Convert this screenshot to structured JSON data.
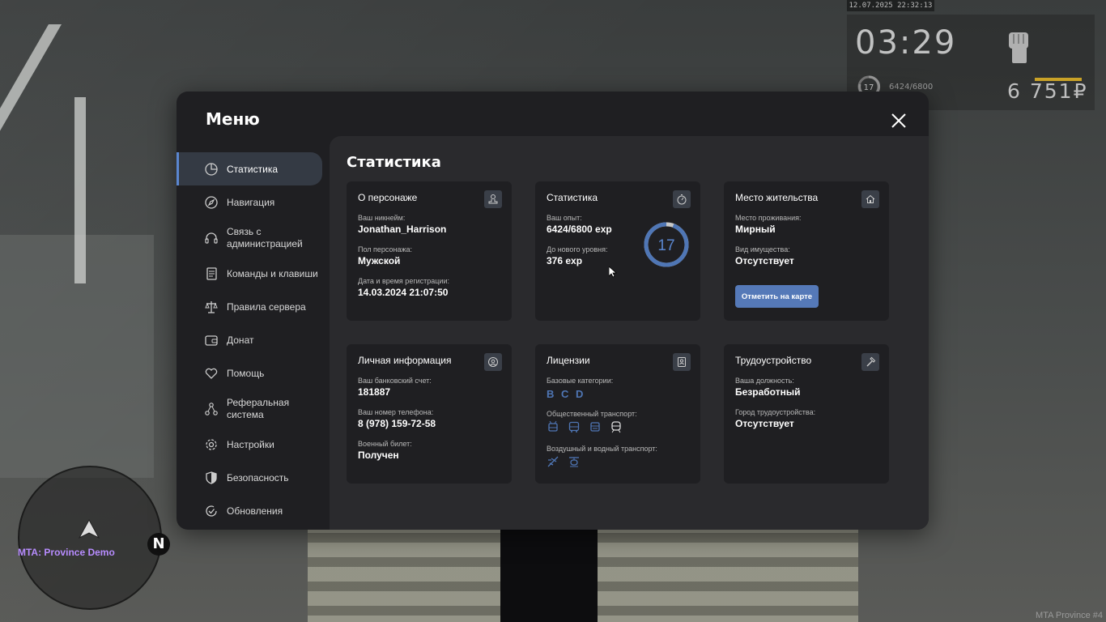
{
  "hud": {
    "datetime": "12.07.2025 22:32:13",
    "time": "03:29",
    "level": "17",
    "exp": "6424/6800",
    "money": "6 751₽"
  },
  "radar": {
    "north": "N"
  },
  "server_label": "MTA: Province Demo",
  "corner_label": "MTA Province #4",
  "menu": {
    "title": "Меню",
    "items": [
      {
        "label": "Статистика",
        "icon": "pie-chart-icon",
        "active": true
      },
      {
        "label": "Навигация",
        "icon": "compass-icon"
      },
      {
        "label": "Связь с\nадминистрацией",
        "icon": "headset-icon"
      },
      {
        "label": "Команды и клавиши",
        "icon": "document-icon"
      },
      {
        "label": "Правила сервера",
        "icon": "scales-icon"
      },
      {
        "label": "Донат",
        "icon": "wallet-icon"
      },
      {
        "label": "Помощь",
        "icon": "heart-hand-icon"
      },
      {
        "label": "Реферальная\nсистема",
        "icon": "network-icon"
      },
      {
        "label": "Настройки",
        "icon": "gear-icon"
      },
      {
        "label": "Безопасность",
        "icon": "shield-icon"
      },
      {
        "label": "Обновления",
        "icon": "refresh-check-icon"
      }
    ]
  },
  "content": {
    "title": "Статистика",
    "character": {
      "title": "О персонаже",
      "nickname_label": "Ваш никнейм:",
      "nickname": "Jonathan_Harrison",
      "gender_label": "Пол персонажа:",
      "gender": "Мужской",
      "reg_label": "Дата и время регистрации:",
      "reg_date": "14.03.2024 21:07:50"
    },
    "stats": {
      "title": "Статистика",
      "exp_label": "Ваш опыт:",
      "exp": "6424/6800 exp",
      "next_label": "До нового уровня:",
      "next": "376 exp",
      "level": "17",
      "progress": 0.945
    },
    "residence": {
      "title": "Место жительства",
      "place_label": "Место проживания:",
      "place": "Мирный",
      "property_label": "Вид имущества:",
      "property": "Отсутствует",
      "map_button": "Отметить на карте"
    },
    "personal": {
      "title": "Личная информация",
      "bank_label": "Ваш банковский счет:",
      "bank": "181887",
      "phone_label": "Ваш номер телефона:",
      "phone": "8 (978) 159-72-58",
      "military_label": "Военный билет:",
      "military": "Получен"
    },
    "licenses": {
      "title": "Лицензии",
      "basic_label": "Базовые категории:",
      "categories": [
        "B",
        "C",
        "D"
      ],
      "public_label": "Общественный транспорт:",
      "air_label": "Воздушный и водный транспорт:"
    },
    "employment": {
      "title": "Трудоустройство",
      "position_label": "Ваша должность:",
      "position": "Безработный",
      "city_label": "Город трудоустройства:",
      "city": "Отсутствует"
    }
  },
  "colors": {
    "accent": "#5579b8",
    "active_bar": "#5a86cf",
    "ring": "#4f76b5"
  }
}
